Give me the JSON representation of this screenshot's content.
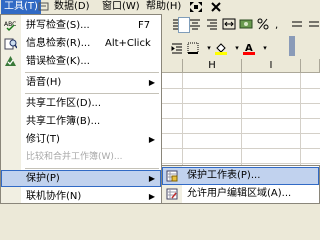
{
  "menubar": {
    "items": [
      {
        "label": "工具(T)"
      },
      {
        "label": "数据(D)"
      },
      {
        "label": "窗口(W)"
      },
      {
        "label": "帮助(H)"
      }
    ]
  },
  "sheet": {
    "columns": [
      "H",
      "I"
    ]
  },
  "tools_menu": {
    "items": [
      {
        "label": "拼写检查(S)...",
        "shortcut": "F7",
        "icon": "spell-check-icon"
      },
      {
        "label": "信息检索(R)...",
        "shortcut": "Alt+Click",
        "icon": "research-icon"
      },
      {
        "label": "错误检查(K)...",
        "icon": "error-check-icon"
      },
      {
        "label": "语音(H)",
        "submenu": true
      },
      {
        "label": "共享工作区(D)..."
      },
      {
        "label": "共享工作簿(B)..."
      },
      {
        "label": "修订(T)",
        "submenu": true
      },
      {
        "label": "比较和合并工作簿(W)...",
        "disabled": true
      },
      {
        "label": "保护(P)",
        "submenu": true,
        "highlighted": true
      },
      {
        "label": "联机协作(N)",
        "submenu": true
      }
    ]
  },
  "protection_submenu": {
    "items": [
      {
        "label": "保护工作表(P)...",
        "icon": "protect-sheet-icon",
        "highlighted": true
      },
      {
        "label": "允许用户编辑区域(A)...",
        "icon": "allow-edit-icon"
      }
    ]
  },
  "colors": {
    "highlight": "#c1d2ee",
    "highlight_border": "#316ac5",
    "menu_bg": "#ffffff",
    "chrome": "#ece9d8"
  }
}
